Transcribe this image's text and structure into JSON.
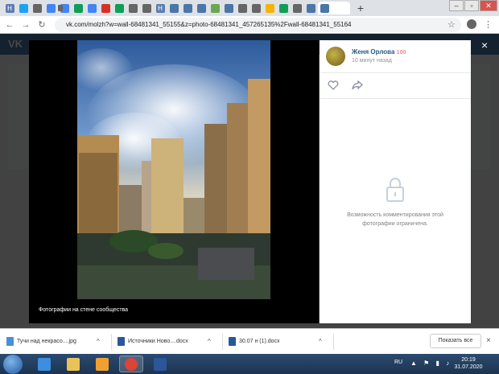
{
  "browser": {
    "tabs": [
      {
        "label": "Н",
        "color": "#5b7db1"
      },
      {
        "label": "",
        "color": "#1da1f2"
      },
      {
        "label": "",
        "color": "#666666"
      },
      {
        "label": "",
        "color": "#4285f4"
      },
      {
        "label": "",
        "color": "#4285f4"
      },
      {
        "label": "",
        "color": "#0f9d58"
      },
      {
        "label": "",
        "color": "#4285f4"
      },
      {
        "label": "",
        "color": "#d93025"
      },
      {
        "label": "",
        "color": "#0f9d58"
      },
      {
        "label": "",
        "color": "#666666"
      },
      {
        "label": "",
        "color": "#666666"
      },
      {
        "label": "Н",
        "color": "#5b7db1"
      },
      {
        "label": "",
        "color": "#4a76a8"
      },
      {
        "label": "",
        "color": "#4a76a8"
      },
      {
        "label": "",
        "color": "#4a76a8"
      },
      {
        "label": "",
        "color": "#6aa84f"
      },
      {
        "label": "",
        "color": "#4a76a8"
      },
      {
        "label": "",
        "color": "#666666"
      },
      {
        "label": "",
        "color": "#666666"
      },
      {
        "label": "",
        "color": "#f4b400"
      },
      {
        "label": "",
        "color": "#0f9d58"
      },
      {
        "label": "",
        "color": "#666666"
      },
      {
        "label": "",
        "color": "#4a76a8"
      }
    ],
    "active_tab_close": "×",
    "new_tab": "+",
    "window_controls": {
      "minimize": "–",
      "maximize": "▫",
      "close": "✕"
    },
    "back": "←",
    "forward": "→",
    "reload": "↻",
    "url": "vk.com/molzh?w=wall-68481341_55155&z=photo-68481341_457265135%2Fwall-68481341_55164",
    "star": "☆",
    "menu": "⋮"
  },
  "vk": {
    "logo": "VK",
    "viewer_close": "×",
    "photo_caption": "Фотографии на стене сообщества",
    "post": {
      "author": "Женя Орлова",
      "author_badge": "100",
      "time": "10 минут назад"
    },
    "comments_restricted": "Возможность комментирования этой фотографии ограничена."
  },
  "downloads": {
    "items": [
      {
        "name": "Тучи над некрасо....jpg",
        "icon_color": "#4a90d9"
      },
      {
        "name": "Источники Ново....docx",
        "icon_color": "#2b579a"
      },
      {
        "name": "30.07 н (1).docx",
        "icon_color": "#2b579a"
      }
    ],
    "arrow": "^",
    "show_all": "Показать все",
    "close": "×"
  },
  "taskbar": {
    "apps": [
      {
        "name": "ie",
        "color": "#3b8ee0"
      },
      {
        "name": "explorer",
        "color": "#e8c35a"
      },
      {
        "name": "media",
        "color": "#f0a030"
      },
      {
        "name": "chrome",
        "color": "#db4437"
      },
      {
        "name": "word",
        "color": "#2b579a"
      }
    ],
    "language": "RU",
    "tray": "▲ ⚑ ▮ ♪",
    "time": "20:19",
    "date": "31.07.2020"
  }
}
